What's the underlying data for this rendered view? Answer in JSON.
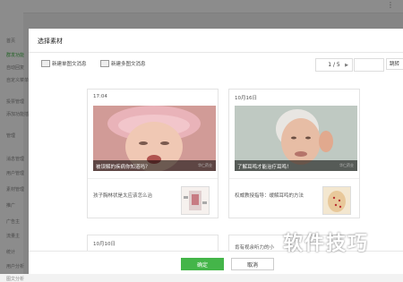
{
  "background": {
    "sidebar_items": [
      "首页",
      "群发功能",
      "自动回复",
      "自定义菜单",
      "投票管理",
      "添加功能插件",
      "管理",
      "消息管理",
      "用户管理",
      "素材管理",
      "推广",
      "广告主",
      "流量主",
      "统计",
      "用户分析",
      "图文分析"
    ]
  },
  "dialog": {
    "title": "选择素材",
    "toolbar": {
      "new_single": "新建单图文消息",
      "new_multi": "新建多图文消息",
      "page_indicator": "1 / 5",
      "go_label": "跳转"
    },
    "cards": [
      {
        "date": "17:04",
        "caption": "被误解的疾病你知道吗？",
        "watermark": "华仁药业",
        "sub_title": "孩子胸林状是太应该怎么治"
      },
      {
        "date": "10月16日",
        "caption": "了解耳鸣才能治疗耳鸣！",
        "watermark": "华仁药业",
        "sub_title": "权威教授指导：缓解耳鸣的方法"
      },
      {
        "date": "10月10日"
      },
      {
        "sub_title": "肯有视余听力的小"
      }
    ],
    "footer": {
      "ok_label": "确定",
      "cancel_label": "取消"
    }
  },
  "brand_watermark": "软件技巧",
  "colors": {
    "accent": "#44b549",
    "overlay": "rgba(0,0,0,0.45)"
  }
}
